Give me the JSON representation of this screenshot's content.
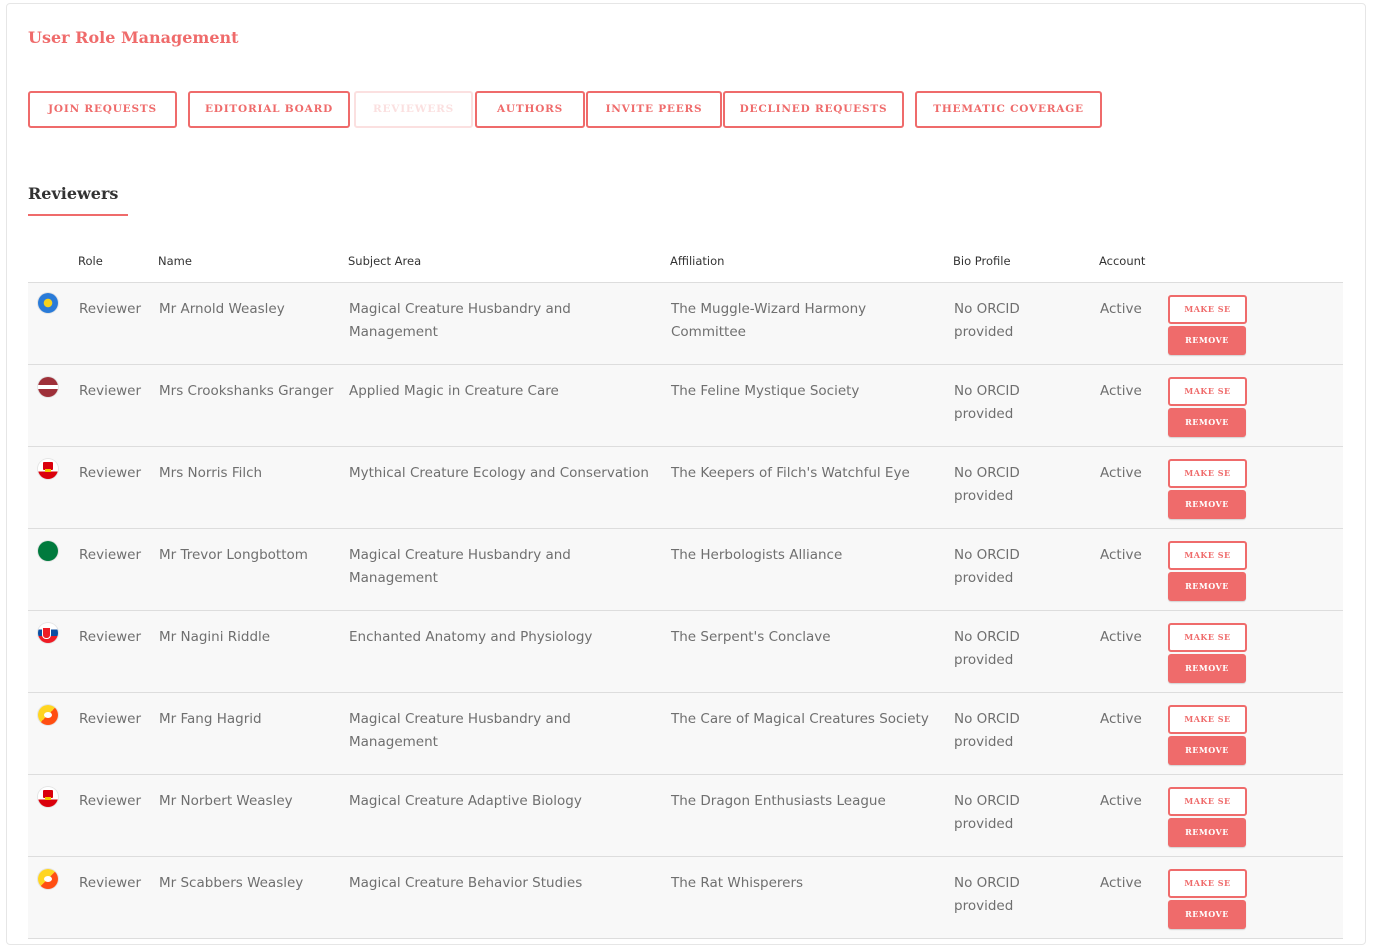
{
  "page_title": "User Role Management",
  "tabs": [
    {
      "label": "JOIN REQUESTS",
      "active": false
    },
    {
      "label": "EDITORIAL BOARD",
      "active": false
    },
    {
      "label": "REVIEWERS",
      "active": true
    },
    {
      "label": "AUTHORS",
      "active": false
    },
    {
      "label": "INVITE PEERS",
      "active": false
    },
    {
      "label": "DECLINED REQUESTS",
      "active": false
    },
    {
      "label": "THEMATIC COVERAGE",
      "active": false
    }
  ],
  "section_title": "Reviewers",
  "table": {
    "headers": {
      "role": "Role",
      "name": "Name",
      "subject": "Subject Area",
      "affiliation": "Affiliation",
      "bio": "Bio Profile",
      "account": "Account"
    },
    "rows": [
      {
        "flag": "flag-icon-circle-blue-yellow",
        "role": "Reviewer",
        "name": "Mr Arnold Weasley",
        "subject": "Magical Creature Husbandry and Management",
        "affiliation": "The Muggle-Wizard Harmony Committee",
        "bio": "No ORCID provided",
        "account": "Active",
        "make_label": "MAKE SE",
        "remove_label": "REMOVE"
      },
      {
        "flag": "flag-icon-latvia",
        "role": "Reviewer",
        "name": "Mrs Crookshanks Granger",
        "subject": "Applied Magic in Creature Care",
        "affiliation": "The Feline Mystique Society",
        "bio": "No ORCID provided",
        "account": "Active",
        "make_label": "MAKE SE",
        "remove_label": "REMOVE"
      },
      {
        "flag": "flag-icon-gibraltar",
        "role": "Reviewer",
        "name": "Mrs Norris Filch",
        "subject": "Mythical Creature Ecology and Conservation",
        "affiliation": "The Keepers of Filch's Watchful Eye",
        "bio": "No ORCID provided",
        "account": "Active",
        "make_label": "MAKE SE",
        "remove_label": "REMOVE"
      },
      {
        "flag": "flag-icon-seychelles",
        "role": "Reviewer",
        "name": "Mr Trevor Longbottom",
        "subject": "Magical Creature Husbandry and Management",
        "affiliation": "The Herbologists Alliance",
        "bio": "No ORCID provided",
        "account": "Active",
        "make_label": "MAKE SE",
        "remove_label": "REMOVE"
      },
      {
        "flag": "flag-icon-slovakia",
        "role": "Reviewer",
        "name": "Mr Nagini Riddle",
        "subject": "Enchanted Anatomy and Physiology",
        "affiliation": "The Serpent's Conclave",
        "bio": "No ORCID provided",
        "account": "Active",
        "make_label": "MAKE SE",
        "remove_label": "REMOVE"
      },
      {
        "flag": "flag-icon-bhutan",
        "role": "Reviewer",
        "name": "Mr Fang Hagrid",
        "subject": "Magical Creature Husbandry and Management",
        "affiliation": "The Care of Magical Creatures Society",
        "bio": "No ORCID provided",
        "account": "Active",
        "make_label": "MAKE SE",
        "remove_label": "REMOVE"
      },
      {
        "flag": "flag-icon-gibraltar",
        "role": "Reviewer",
        "name": "Mr Norbert Weasley",
        "subject": "Magical Creature Adaptive Biology",
        "affiliation": "The Dragon Enthusiasts League",
        "bio": "No ORCID provided",
        "account": "Active",
        "make_label": "MAKE SE",
        "remove_label": "REMOVE"
      },
      {
        "flag": "flag-icon-bhutan",
        "role": "Reviewer",
        "name": "Mr Scabbers Weasley",
        "subject": "Magical Creature Behavior Studies",
        "affiliation": "The Rat Whisperers",
        "bio": "No ORCID provided",
        "account": "Active",
        "make_label": "MAKE SE",
        "remove_label": "REMOVE"
      }
    ]
  },
  "colors": {
    "accent": "#ef6b6b",
    "row_bg": "#f8f8f8",
    "text_muted": "#6f6f6f"
  }
}
